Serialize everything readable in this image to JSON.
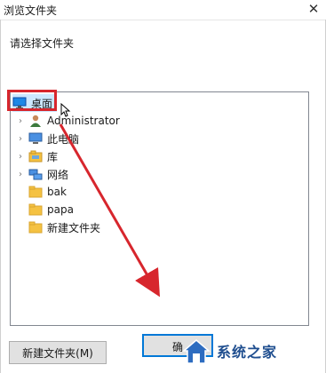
{
  "window": {
    "title": "浏览文件夹",
    "close_symbol": "✕"
  },
  "prompt": "请选择文件夹",
  "tree": {
    "items": [
      {
        "label": "桌面",
        "icon": "desktop-icon",
        "expander": "",
        "selected": true
      },
      {
        "label": "Administrator",
        "icon": "user-icon",
        "expander": "›"
      },
      {
        "label": "此电脑",
        "icon": "computer-icon",
        "expander": "›"
      },
      {
        "label": "库",
        "icon": "library-icon",
        "expander": "›"
      },
      {
        "label": "网络",
        "icon": "network-icon",
        "expander": "›"
      },
      {
        "label": "bak",
        "icon": "folder-icon",
        "expander": ""
      },
      {
        "label": "papa",
        "icon": "folder-icon",
        "expander": ""
      },
      {
        "label": "新建文件夹",
        "icon": "folder-icon",
        "expander": ""
      }
    ]
  },
  "buttons": {
    "new_folder": "新建文件夹(M)",
    "ok": "确"
  },
  "watermark": {
    "text": "系统之家"
  },
  "colors": {
    "annotation": "#d7262d",
    "selection": "#cce8ff",
    "folder": "#f5c242"
  }
}
